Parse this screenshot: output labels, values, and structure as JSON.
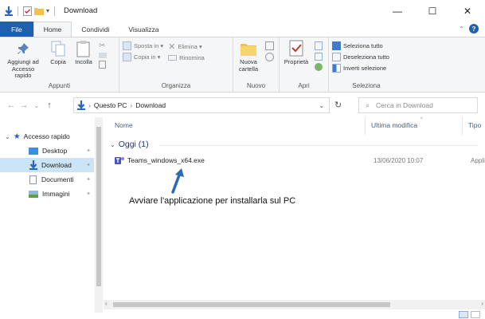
{
  "window": {
    "title": "Download",
    "controls": [
      "—",
      "☐",
      "✕"
    ]
  },
  "ribbon_tabs": [
    "File",
    "Home",
    "Condividi",
    "Visualizza"
  ],
  "ribbon": {
    "appunti": {
      "label": "Appunti",
      "pin": "Aggiungi ad Accesso rapido",
      "copy": "Copia",
      "paste": "Incolla"
    },
    "organizza": {
      "label": "Organizza",
      "move_to": "Sposta in ▾",
      "copy_to": "Copia in ▾",
      "delete": "Elimina ▾",
      "rename": "Rinomina"
    },
    "nuovo": {
      "label": "Nuovo",
      "new_folder": "Nuova cartella"
    },
    "apri": {
      "label": "Apri",
      "properties": "Proprietà"
    },
    "seleziona": {
      "label": "Seleziona",
      "select_all": "Seleziona tutto",
      "select_none": "Deseleziona tutto",
      "invert": "Inverti selezione"
    }
  },
  "address": {
    "segments": [
      "Questo PC",
      "Download"
    ],
    "search_placeholder": "Cerca in Download"
  },
  "nav": {
    "items": [
      {
        "label": "Accesso rapido",
        "icon": "star-icon"
      },
      {
        "label": "Desktop",
        "icon": "desktop-icon"
      },
      {
        "label": "Download",
        "icon": "download-icon"
      },
      {
        "label": "Documenti",
        "icon": "document-icon"
      },
      {
        "label": "Immagini",
        "icon": "pictures-icon"
      }
    ]
  },
  "columns": {
    "name": "Nome",
    "modified": "Ultima modifica",
    "type": "Tipo"
  },
  "group": {
    "label": "Oggi (1)"
  },
  "files": [
    {
      "name": "Teams_windows_x64.exe",
      "modified": "13/06/2020 10:07",
      "type": "Appli"
    }
  ],
  "annotation": "Avviare l'applicazione per installarla sul PC",
  "colors": {
    "file_tab": "#1f5fb0",
    "selection": "#cce4f7",
    "annotation_arrow": "#2e68b8",
    "group_header": "#1e3287"
  }
}
